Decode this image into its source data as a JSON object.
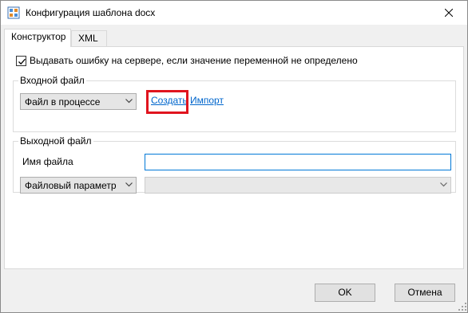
{
  "window": {
    "title": "Конфигурация шаблона docx"
  },
  "tabs": [
    {
      "label": "Конструктор",
      "active": true
    },
    {
      "label": "XML",
      "active": false
    }
  ],
  "options": {
    "error_checkbox_label": "Выдавать ошибку на сервере, если значение переменной не определено",
    "error_checkbox_checked": true
  },
  "input_file": {
    "group_title": "Входной файл",
    "source_type": "Файл в процессе",
    "create_link": "Создать",
    "import_link": "Импорт"
  },
  "output_file": {
    "group_title": "Выходной файл",
    "filename_label": "Имя файла",
    "filename_value": "",
    "param_type": "Файловый параметр",
    "param_value": ""
  },
  "buttons": {
    "ok": "OK",
    "cancel": "Отмена"
  },
  "icons": {
    "app": "docx-template-icon",
    "close": "close-icon",
    "chevron": "chevron-down-icon",
    "checkmark": "checkmark-icon"
  },
  "colors": {
    "link": "#0066cc",
    "highlight": "#e0141e",
    "focus_border": "#0078d7"
  }
}
